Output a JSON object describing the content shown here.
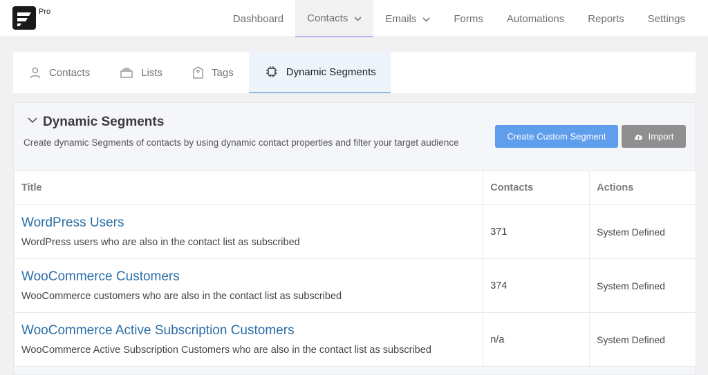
{
  "brand": {
    "badge": "Pro"
  },
  "topnav": [
    {
      "label": "Dashboard",
      "active": false,
      "dropdown": false
    },
    {
      "label": "Contacts",
      "active": true,
      "dropdown": true
    },
    {
      "label": "Emails",
      "active": false,
      "dropdown": true
    },
    {
      "label": "Forms",
      "active": false,
      "dropdown": false
    },
    {
      "label": "Automations",
      "active": false,
      "dropdown": false
    },
    {
      "label": "Reports",
      "active": false,
      "dropdown": false
    },
    {
      "label": "Settings",
      "active": false,
      "dropdown": false
    }
  ],
  "subtabs": [
    {
      "label": "Contacts",
      "icon": "user-icon"
    },
    {
      "label": "Lists",
      "icon": "list-icon"
    },
    {
      "label": "Tags",
      "icon": "tag-icon"
    },
    {
      "label": "Dynamic Segments",
      "icon": "chip-icon",
      "active": true
    }
  ],
  "panel": {
    "title": "Dynamic Segments",
    "description": "Create dynamic Segments of contacts by using dynamic contact properties and filter your target audience",
    "create_button": "Create Custom Segment",
    "import_button": "Import"
  },
  "table": {
    "headers": [
      "Title",
      "Contacts",
      "Actions"
    ],
    "rows": [
      {
        "title": "WordPress Users",
        "description": "WordPress users who are also in the contact list as subscribed",
        "contacts": "371",
        "actions": "System Defined"
      },
      {
        "title": "WooCommerce Customers",
        "description": "WooCommerce customers who are also in the contact list as subscribed",
        "contacts": "374",
        "actions": "System Defined"
      },
      {
        "title": "WooCommerce Active Subscription Customers",
        "description": "WooCommerce Active Subscription Customers who are also in the contact list as subscribed",
        "contacts": "n/a",
        "actions": "System Defined"
      }
    ]
  },
  "colors": {
    "accent": "#5f9ded",
    "link": "#2b6ea8",
    "active_tab_bg": "#eef4fb"
  }
}
